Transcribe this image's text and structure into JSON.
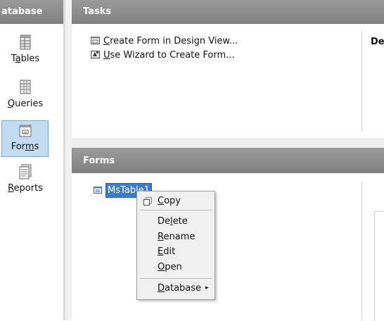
{
  "left_pane": {
    "header": "atabase",
    "categories": [
      {
        "label": "Tables",
        "mnemonic_prefix": "T",
        "mnemonic": "a",
        "rest": "bles",
        "icon": "tables-icon"
      },
      {
        "label": "Queries",
        "mnemonic_prefix": "",
        "mnemonic": "Q",
        "rest": "ueries",
        "icon": "queries-icon"
      },
      {
        "label": "Forms",
        "mnemonic_prefix": "For",
        "mnemonic": "m",
        "rest": "s",
        "icon": "forms-icon",
        "selected": true
      },
      {
        "label": "Reports",
        "mnemonic_prefix": "",
        "mnemonic": "R",
        "rest": "eports",
        "icon": "reports-icon"
      }
    ]
  },
  "tasks": {
    "header": "Tasks",
    "items": [
      {
        "mnemonic": "C",
        "rest": "reate Form in Design View...",
        "icon": "design-view-icon"
      },
      {
        "mnemonic": "U",
        "rest": "se Wizard to Create Form...",
        "icon": "wizard-icon"
      }
    ],
    "description_label": "Des"
  },
  "forms": {
    "header": "Forms",
    "items": [
      {
        "label": "MsTable1",
        "icon": "form-document-icon",
        "selected": true
      }
    ]
  },
  "context_menu": {
    "items": [
      {
        "pre": "",
        "mnemonic": "C",
        "rest": "opy"
      },
      {
        "pre": "De",
        "mnemonic": "l",
        "rest": "ete"
      },
      {
        "pre": "",
        "mnemonic": "R",
        "rest": "ename"
      },
      {
        "pre": "",
        "mnemonic": "E",
        "rest": "dit"
      },
      {
        "pre": "",
        "mnemonic": "O",
        "rest": "pen"
      },
      {
        "pre": "",
        "mnemonic": "D",
        "rest": "atabase",
        "submenu_arrow": "▸"
      }
    ]
  },
  "colors": {
    "header_gray": "#8c8c8c",
    "selection_blue": "#3d7cc9",
    "category_selected_bg": "#c4dcf2"
  }
}
